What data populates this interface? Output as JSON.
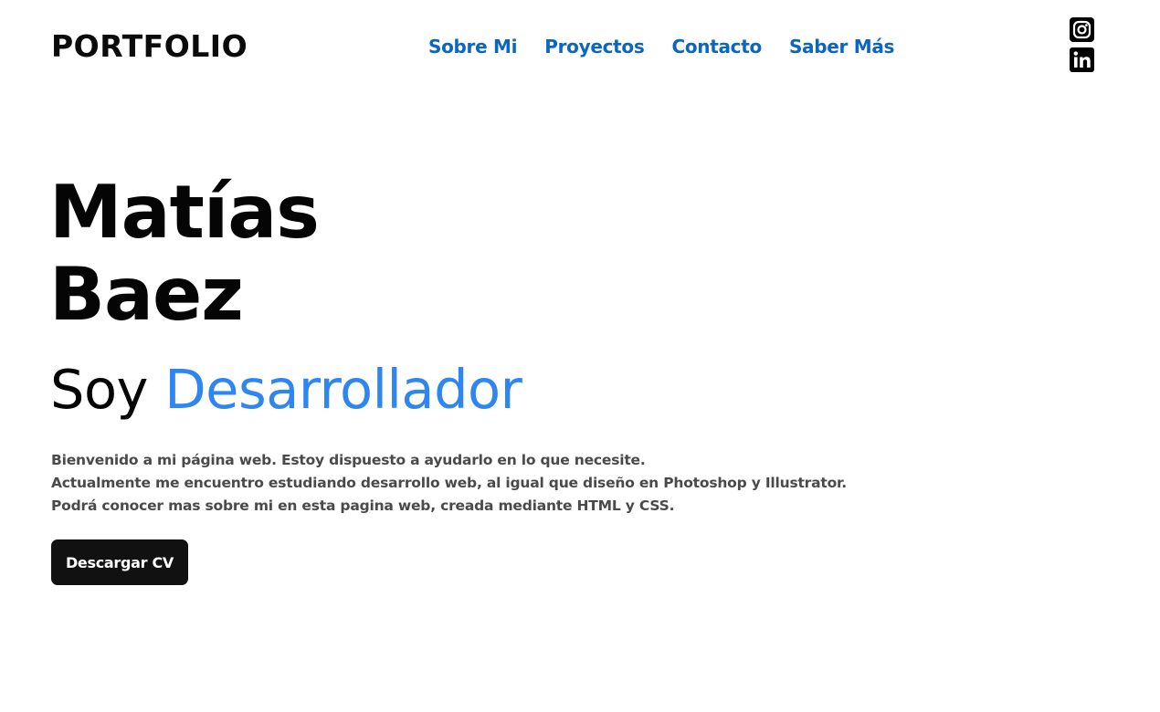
{
  "header": {
    "logo": "PORTFOLIO",
    "nav": [
      {
        "label": "Sobre Mi"
      },
      {
        "label": "Proyectos"
      },
      {
        "label": "Contacto"
      },
      {
        "label": "Saber Más"
      }
    ],
    "socials": [
      {
        "icon": "instagram-icon"
      },
      {
        "icon": "linkedin-icon"
      }
    ]
  },
  "hero": {
    "first_name": "Matías",
    "last_name": "Baez",
    "role_prefix": "Soy",
    "role_highlight": "Desarrollador",
    "description": [
      "Bienvenido a mi página web. Estoy dispuesto a ayudarlo en lo que necesite.",
      "Actualmente me encuentro estudiando desarrollo web, al igual que diseño en Photoshop y Illustrator.",
      "Podrá conocer mas sobre mi en esta pagina web, creada mediante HTML y CSS."
    ],
    "cv_button": "Descargar CV"
  },
  "colors": {
    "nav_link": "#0a66c2",
    "accent": "#2f86f0",
    "text": "#050505",
    "muted_text": "#4a4a4a",
    "button_bg": "#111111",
    "button_text": "#ffffff",
    "background": "#ffffff"
  }
}
